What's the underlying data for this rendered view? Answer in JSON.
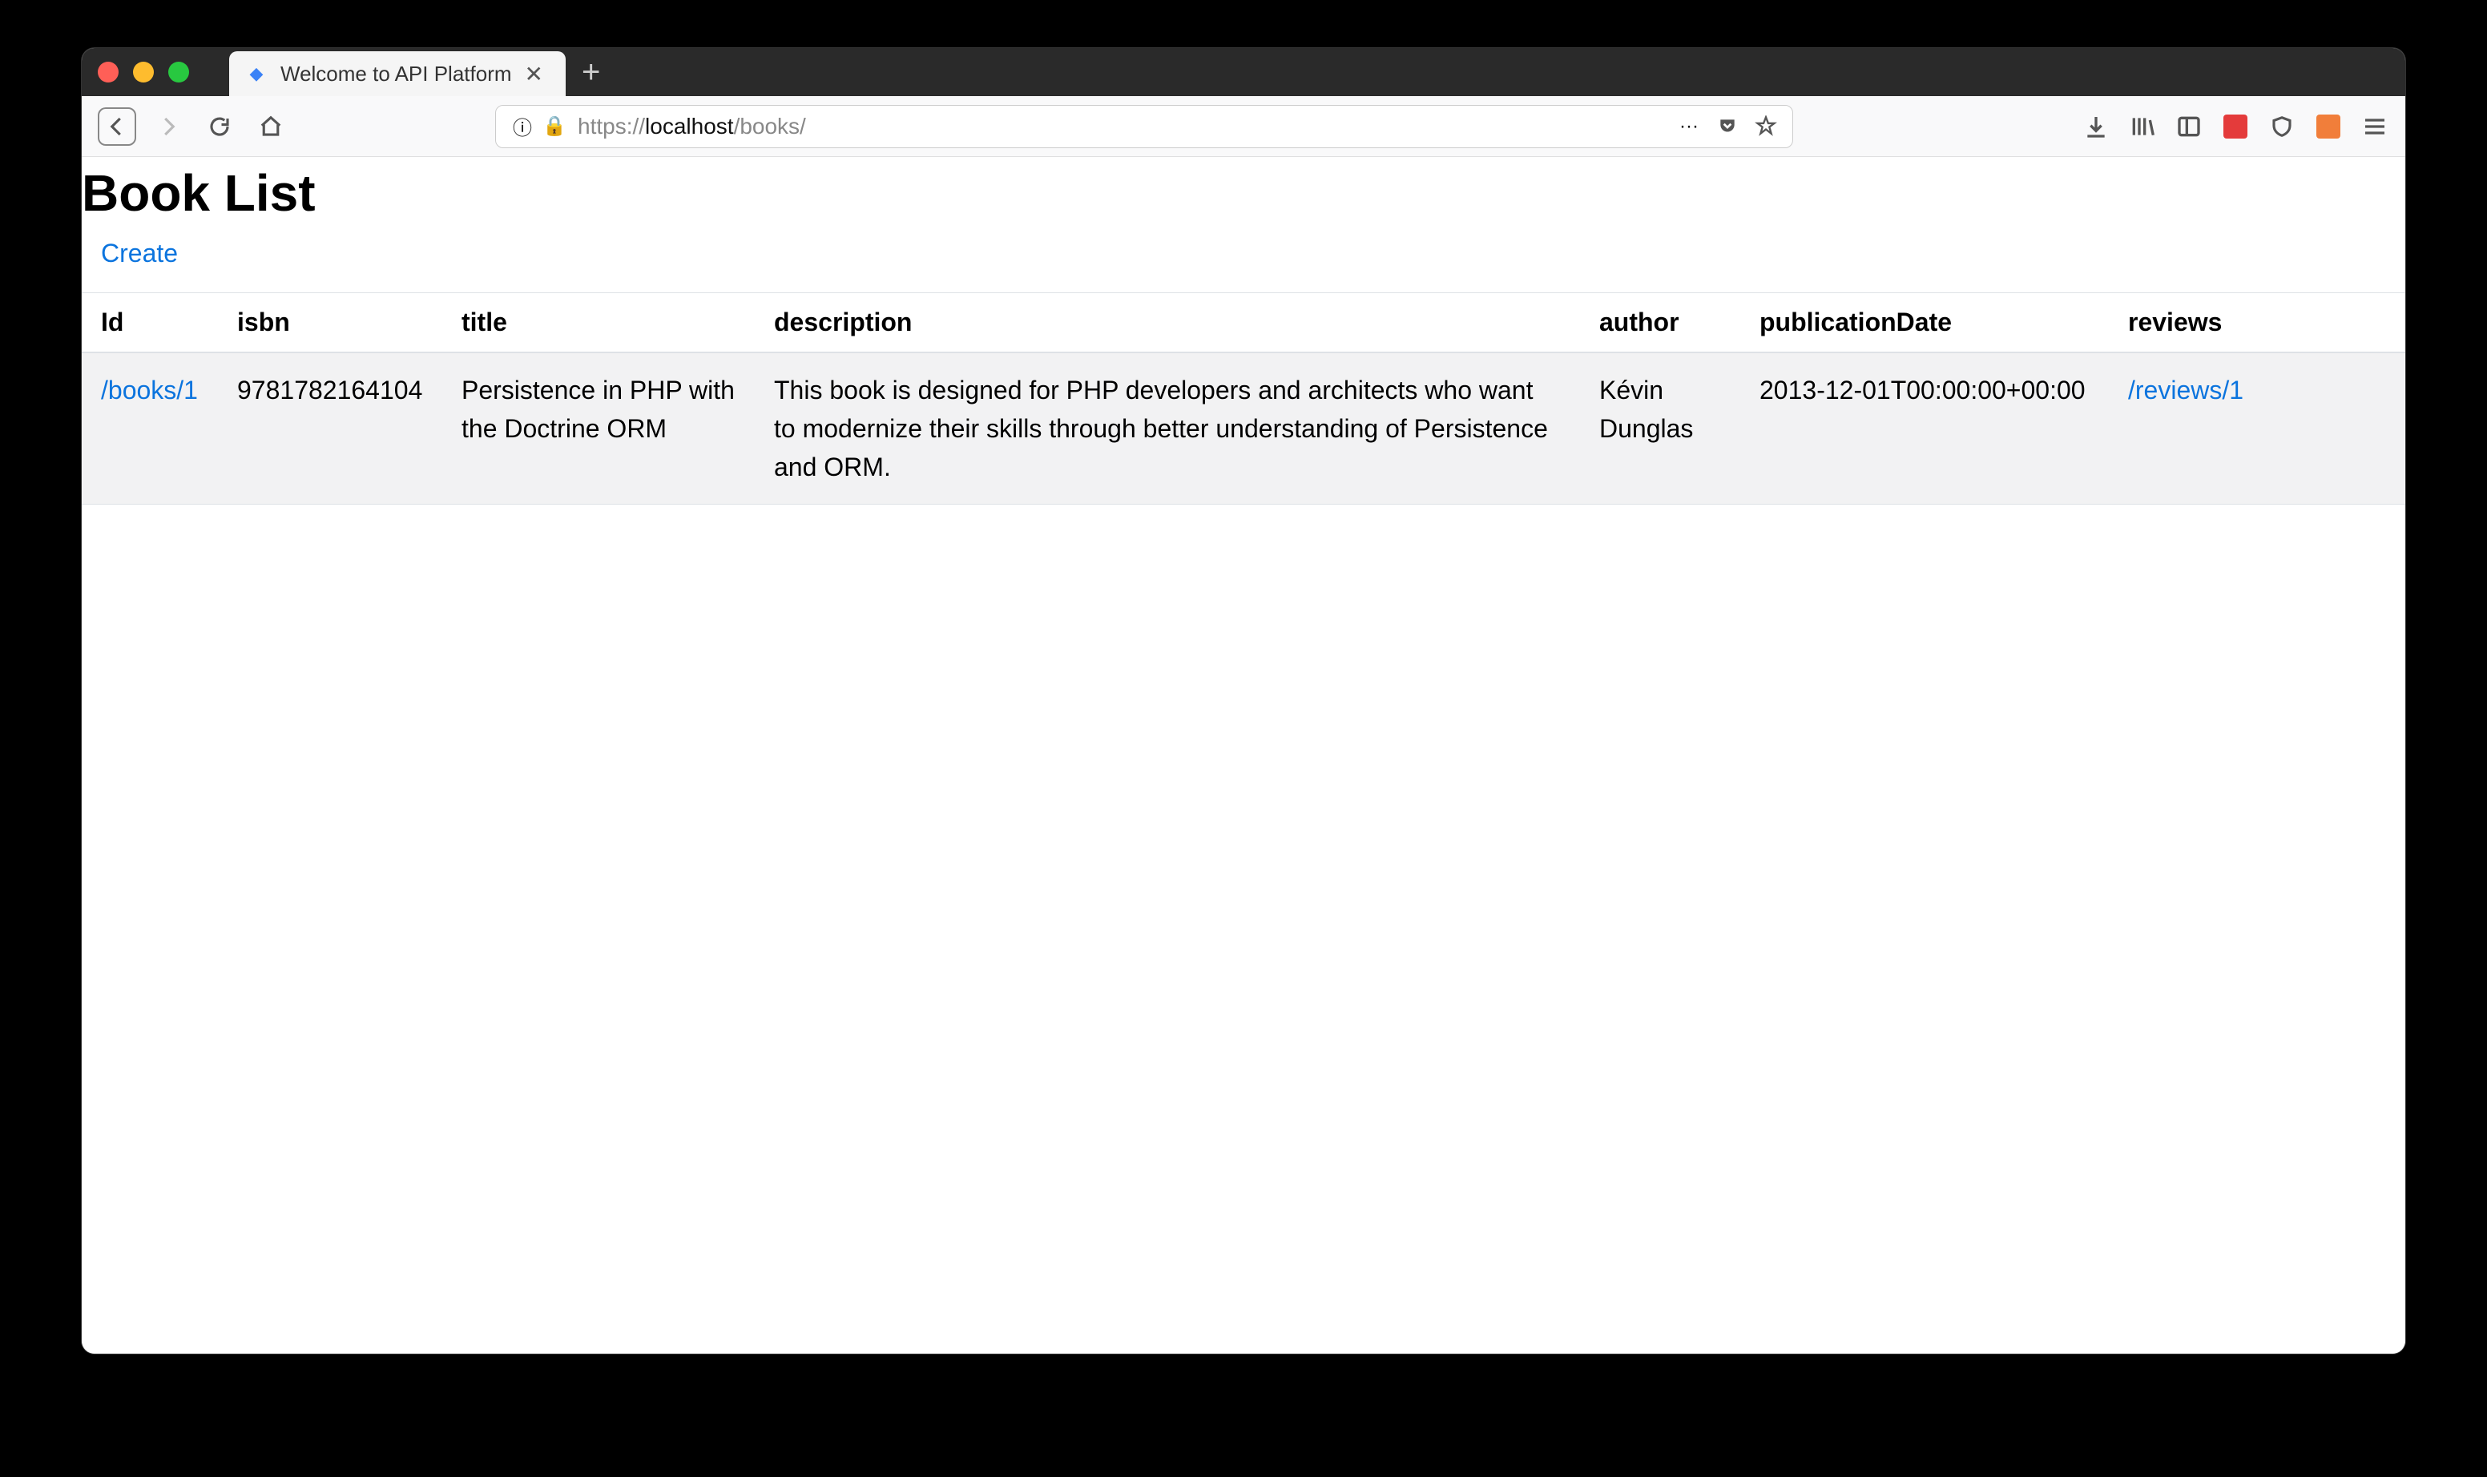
{
  "browser": {
    "tab_title": "Welcome to API Platform",
    "url_prefix": "https://",
    "url_host": "localhost",
    "url_path": "/books/"
  },
  "page": {
    "heading": "Book List",
    "create_label": "Create"
  },
  "table": {
    "headers": {
      "id": "Id",
      "isbn": "isbn",
      "title": "title",
      "description": "description",
      "author": "author",
      "publicationDate": "publicationDate",
      "reviews": "reviews"
    },
    "rows": [
      {
        "id_link": "/books/1",
        "isbn": "9781782164104",
        "title": "Persistence in PHP with the Doctrine ORM",
        "description": "This book is designed for PHP developers and architects who want to modernize their skills through better understanding of Persistence and ORM.",
        "author": "Kévin Dunglas",
        "publicationDate": "2013-12-01T00:00:00+00:00",
        "reviews_link": "/reviews/1"
      }
    ]
  }
}
